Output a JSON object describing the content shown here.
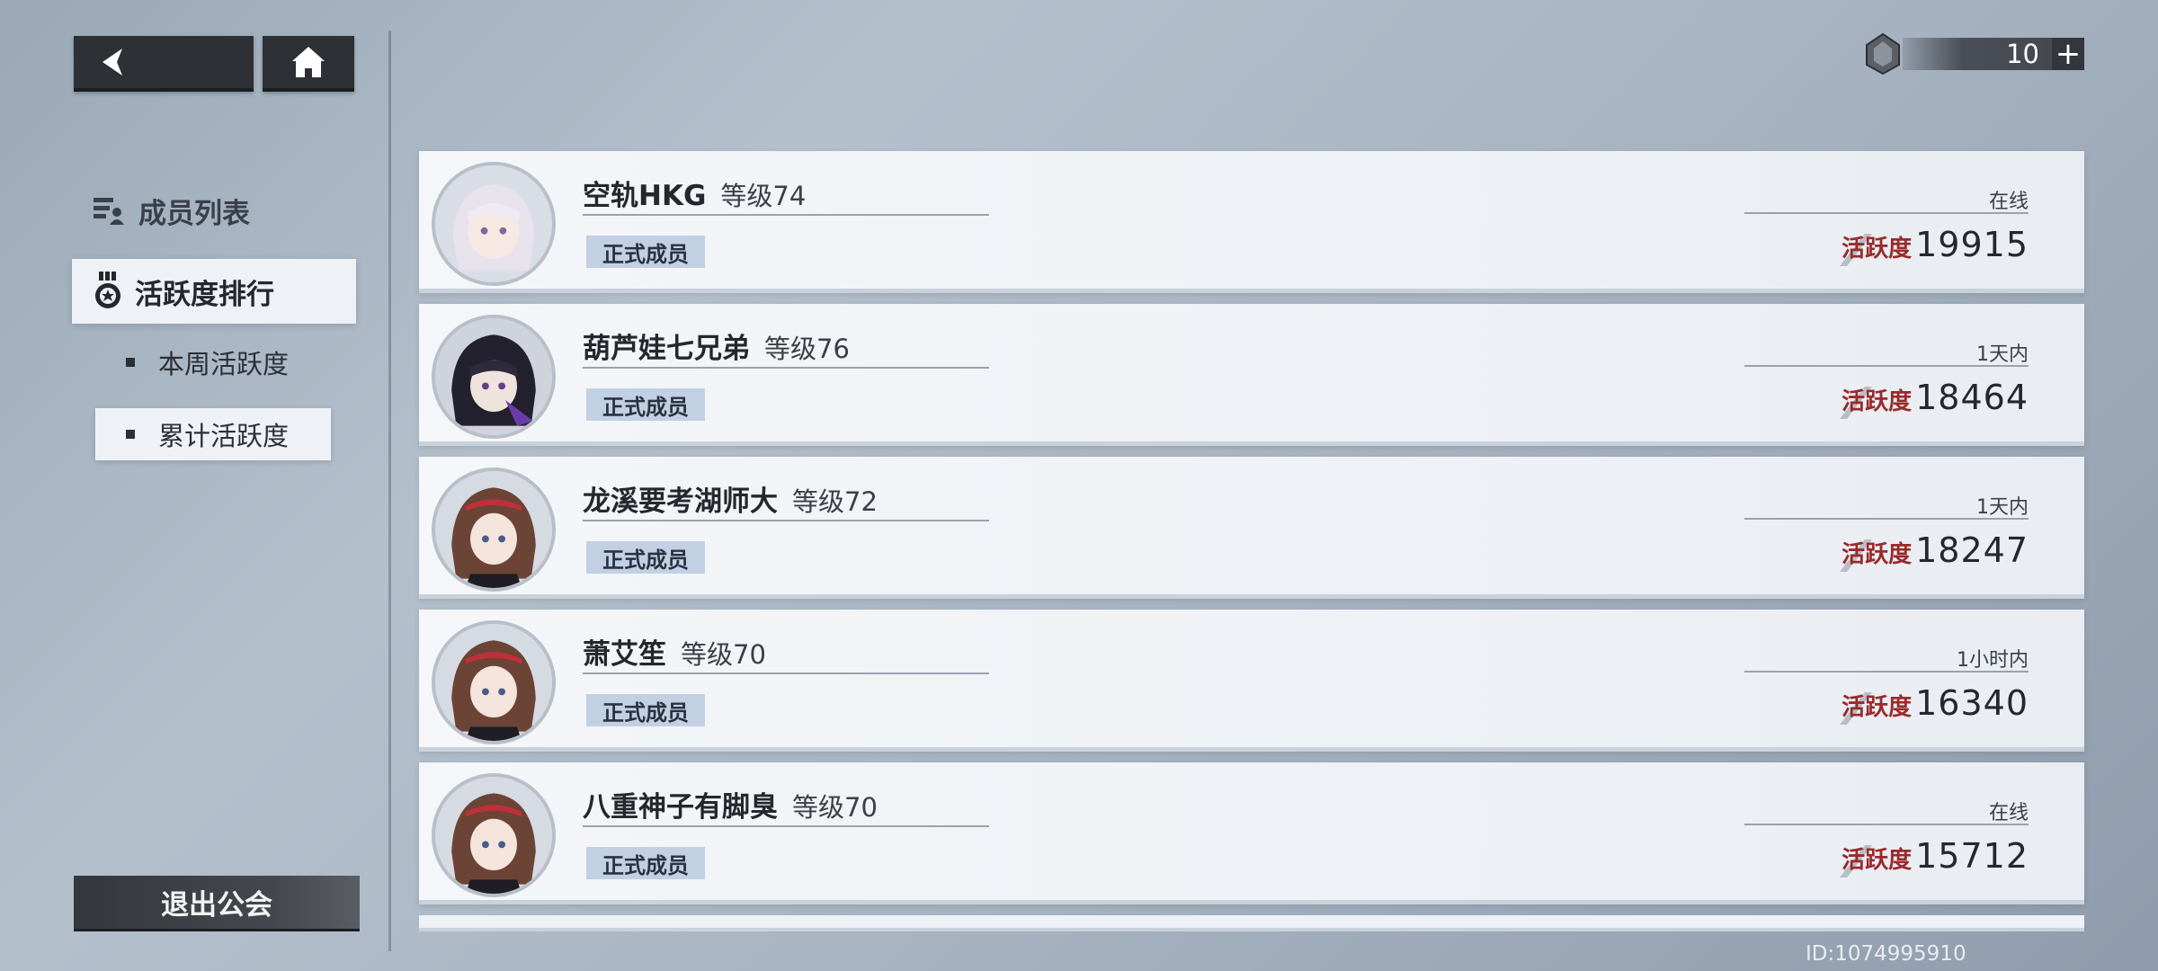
{
  "nav": {
    "member_list": "成员列表",
    "activity_rank": "活跃度排行",
    "week_activity": "本周活跃度",
    "total_activity": "累计活跃度",
    "leave_guild": "退出公会"
  },
  "currency": {
    "value": "10",
    "plus": "+"
  },
  "members": [
    {
      "name": "空轨HKG",
      "level": "等级74",
      "role": "正式成员",
      "status": "在线",
      "activity_label": "活跃度",
      "activity": "19915",
      "avatar": "white-hair-avatar"
    },
    {
      "name": "葫芦娃七兄弟",
      "level": "等级76",
      "role": "正式成员",
      "status": "1天内",
      "activity_label": "活跃度",
      "activity": "18464",
      "avatar": "dark-hair-avatar"
    },
    {
      "name": "龙溪要考湖师大",
      "level": "等级72",
      "role": "正式成员",
      "status": "1天内",
      "activity_label": "活跃度",
      "activity": "18247",
      "avatar": "brown-hair-avatar"
    },
    {
      "name": "萧艾笙",
      "level": "等级70",
      "role": "正式成员",
      "status": "1小时内",
      "activity_label": "活跃度",
      "activity": "16340",
      "avatar": "brown-hair-avatar"
    },
    {
      "name": "八重神子有脚臭",
      "level": "等级70",
      "role": "正式成员",
      "status": "在线",
      "activity_label": "活跃度",
      "activity": "15712",
      "avatar": "brown-hair-avatar"
    }
  ],
  "player_id": "ID:1074995910",
  "colors": {
    "accent_red": "#9a2a2a",
    "badge_blue": "#c2d0e4",
    "dark_button": "#2d3035"
  }
}
